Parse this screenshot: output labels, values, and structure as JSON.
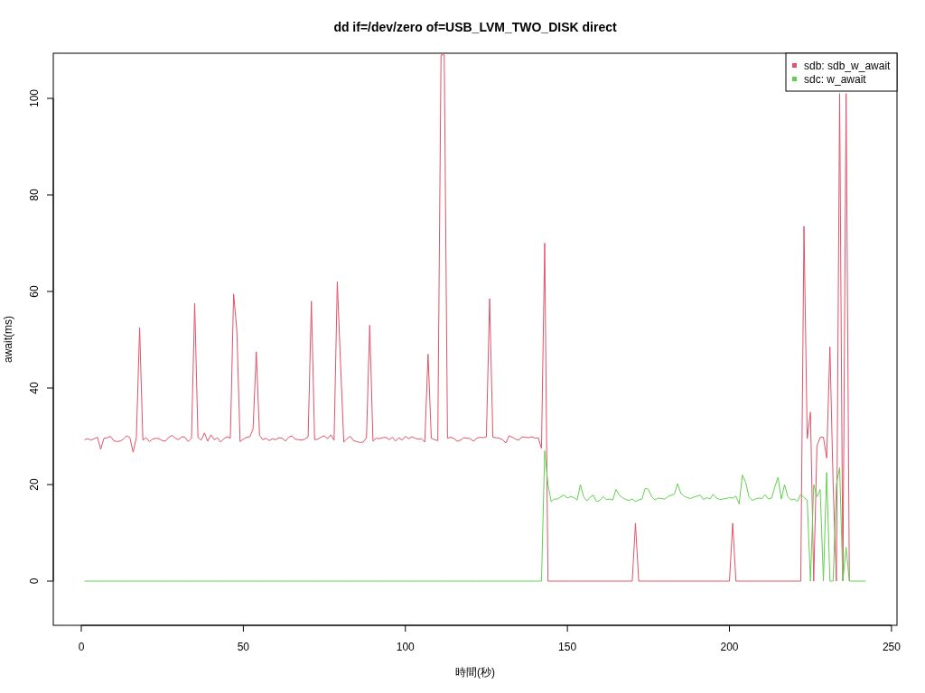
{
  "chart_data": {
    "type": "line",
    "title": "dd if=/dev/zero of=USB_LVM_TWO_DISK direct",
    "xlabel": "時間(秒)",
    "ylabel": "await(ms)",
    "xlim": [
      -8.64,
      251.7
    ],
    "ylim": [
      -9.16,
      109.35
    ],
    "xticks": [
      0,
      50,
      100,
      150,
      200,
      250
    ],
    "yticks": [
      0,
      20,
      40,
      60,
      80,
      100
    ],
    "legend": true,
    "x": [
      1,
      2,
      3,
      4,
      5,
      6,
      7,
      8,
      9,
      10,
      11,
      12,
      13,
      14,
      15,
      16,
      17,
      18,
      19,
      20,
      21,
      22,
      23,
      24,
      25,
      26,
      27,
      28,
      29,
      30,
      31,
      32,
      33,
      34,
      35,
      36,
      37,
      38,
      39,
      40,
      41,
      42,
      43,
      44,
      45,
      46,
      47,
      48,
      49,
      50,
      51,
      52,
      53,
      54,
      55,
      56,
      57,
      58,
      59,
      60,
      61,
      62,
      63,
      64,
      65,
      66,
      67,
      68,
      69,
      70,
      71,
      72,
      73,
      74,
      75,
      76,
      77,
      78,
      79,
      80,
      81,
      82,
      83,
      84,
      85,
      86,
      87,
      88,
      89,
      90,
      91,
      92,
      93,
      94,
      95,
      96,
      97,
      98,
      99,
      100,
      101,
      102,
      103,
      104,
      105,
      106,
      107,
      108,
      109,
      110,
      111,
      112,
      113,
      114,
      115,
      116,
      117,
      118,
      119,
      120,
      121,
      122,
      123,
      124,
      125,
      126,
      127,
      128,
      129,
      130,
      131,
      132,
      133,
      134,
      135,
      136,
      137,
      138,
      139,
      140,
      141,
      142,
      143,
      144,
      145,
      146,
      147,
      148,
      149,
      150,
      151,
      152,
      153,
      154,
      155,
      156,
      157,
      158,
      159,
      160,
      161,
      162,
      163,
      164,
      165,
      166,
      167,
      168,
      169,
      170,
      171,
      172,
      173,
      174,
      175,
      176,
      177,
      178,
      179,
      180,
      181,
      182,
      183,
      184,
      185,
      186,
      187,
      188,
      189,
      190,
      191,
      192,
      193,
      194,
      195,
      196,
      197,
      198,
      199,
      200,
      201,
      202,
      203,
      204,
      205,
      206,
      207,
      208,
      209,
      210,
      211,
      212,
      213,
      214,
      215,
      216,
      217,
      218,
      219,
      220,
      221,
      222,
      223,
      224,
      225,
      226,
      227,
      228,
      229,
      230,
      231,
      232,
      233,
      234,
      235,
      236,
      237,
      238,
      239,
      240,
      241,
      242
    ],
    "series": [
      {
        "name": "sdb: sdb_w_await",
        "color": "#df536b",
        "values": [
          29.3,
          29.5,
          29.2,
          29.5,
          29.8,
          27.3,
          29.6,
          29.7,
          30.0,
          29.1,
          28.9,
          29.0,
          29.4,
          30.1,
          29.7,
          26.7,
          29.8,
          52.5,
          29.2,
          29.7,
          28.9,
          29.4,
          29.6,
          29.5,
          29.1,
          29.0,
          29.8,
          30.2,
          29.6,
          29.3,
          29.9,
          29.8,
          28.9,
          29.6,
          57.5,
          29.8,
          29.2,
          30.7,
          29.0,
          30.3,
          29.3,
          29.7,
          28.8,
          29.5,
          29.9,
          29.6,
          59.5,
          52.0,
          28.9,
          29.4,
          29.8,
          29.9,
          31.5,
          47.5,
          30.2,
          29.3,
          29.6,
          29.1,
          29.5,
          29.3,
          29.7,
          29.6,
          29.0,
          29.8,
          30.1,
          29.4,
          29.3,
          29.2,
          29.4,
          29.9,
          58.0,
          29.3,
          29.4,
          29.8,
          30.1,
          29.5,
          30.3,
          29.2,
          62.0,
          45.0,
          28.8,
          29.5,
          30.0,
          29.1,
          28.9,
          28.7,
          28.8,
          29.7,
          53.0,
          29.0,
          29.6,
          29.5,
          29.7,
          29.8,
          29.3,
          29.8,
          29.0,
          29.7,
          29.2,
          30.0,
          29.5,
          29.9,
          29.6,
          29.4,
          29.5,
          28.8,
          47.0,
          29.6,
          29.3,
          29.1,
          109,
          109,
          29.6,
          29.8,
          29.5,
          29.0,
          29.2,
          29.7,
          29.6,
          29.5,
          29.0,
          29.6,
          29.8,
          29.7,
          29.9,
          58.5,
          29.8,
          29.7,
          29.6,
          29.3,
          28.6,
          30.1,
          29.8,
          29.4,
          29.2,
          29.9,
          29.8,
          29.7,
          29.9,
          29.6,
          29.7,
          27.5,
          70.0,
          0,
          0,
          0,
          0,
          0,
          0,
          0,
          0,
          0,
          0,
          0,
          0,
          0,
          0,
          0,
          0,
          0,
          0,
          0,
          0,
          0,
          0,
          0,
          0,
          0,
          0,
          0,
          12,
          0,
          0,
          0,
          0,
          0,
          0,
          0,
          0,
          0,
          0,
          0,
          0,
          0,
          0,
          0,
          0,
          0,
          0,
          0,
          0,
          0,
          0,
          0,
          0,
          0,
          0,
          0,
          0,
          0,
          12,
          0,
          0,
          0,
          0,
          0,
          0,
          0,
          0,
          0,
          0,
          0,
          0,
          0,
          0,
          0,
          0,
          0,
          0,
          0,
          0,
          0,
          73.5,
          29.5,
          35.0,
          0,
          28.0,
          29.8,
          29.8,
          25.5,
          48.5,
          20,
          0,
          101,
          0,
          101,
          0,
          null,
          null,
          null,
          null,
          null
        ]
      },
      {
        "name": "sdc: w_await",
        "color": "#61d04f",
        "values": [
          0,
          0,
          0,
          0,
          0,
          0,
          0,
          0,
          0,
          0,
          0,
          0,
          0,
          0,
          0,
          0,
          0,
          0,
          0,
          0,
          0,
          0,
          0,
          0,
          0,
          0,
          0,
          0,
          0,
          0,
          0,
          0,
          0,
          0,
          0,
          0,
          0,
          0,
          0,
          0,
          0,
          0,
          0,
          0,
          0,
          0,
          0,
          0,
          0,
          0,
          0,
          0,
          0,
          0,
          0,
          0,
          0,
          0,
          0,
          0,
          0,
          0,
          0,
          0,
          0,
          0,
          0,
          0,
          0,
          0,
          0,
          0,
          0,
          0,
          0,
          0,
          0,
          0,
          0,
          0,
          0,
          0,
          0,
          0,
          0,
          0,
          0,
          0,
          0,
          0,
          0,
          0,
          0,
          0,
          0,
          0,
          0,
          0,
          0,
          0,
          0,
          0,
          0,
          0,
          0,
          0,
          0,
          0,
          0,
          0,
          0,
          0,
          0,
          0,
          0,
          0,
          0,
          0,
          0,
          0,
          0,
          0,
          0,
          0,
          0,
          0,
          0,
          0,
          0,
          0,
          0,
          0,
          0,
          0,
          0,
          0,
          0,
          0,
          0,
          0,
          0,
          0,
          27,
          20,
          16.5,
          17,
          17,
          17.5,
          17.8,
          17.2,
          17.5,
          17.3,
          16.8,
          20,
          17.5,
          16.6,
          17.4,
          17.8,
          16.5,
          16.7,
          17.5,
          16.9,
          17.0,
          16.8,
          19.0,
          17.8,
          17.3,
          16.9,
          16.7,
          17.0,
          16.5,
          16.8,
          17.0,
          19.2,
          19.0,
          17.5,
          16.8,
          17.2,
          17.1,
          17.0,
          17.5,
          17.8,
          18.0,
          20.2,
          18.2,
          17.6,
          17.3,
          17.1,
          17.4,
          17.6,
          17.8,
          16.9,
          17.3,
          17.0,
          18.0,
          17.2,
          16.9,
          17.0,
          17.1,
          17.3,
          17.2,
          17.6,
          16.0,
          22.0,
          20.5,
          17.5,
          16.7,
          17.0,
          17.2,
          17.1,
          17.9,
          17.0,
          17.2,
          19.5,
          21.5,
          17.0,
          20.0,
          17.5,
          16.8,
          17.0,
          16.5,
          18.0,
          17.3,
          16.8,
          0,
          20.0,
          17.5,
          19.0,
          0,
          22.5,
          0,
          0,
          20.0,
          23.5,
          0,
          7.0,
          0,
          0,
          0,
          0,
          0,
          0
        ]
      }
    ]
  }
}
